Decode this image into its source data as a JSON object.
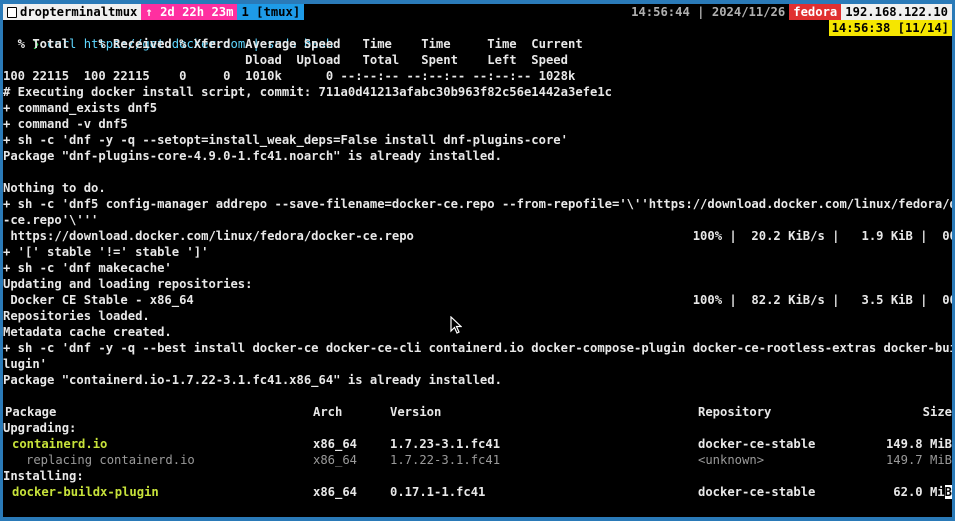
{
  "status_bar": {
    "session_name": "dropterminaltmux",
    "uptime": "↑ 2d 22h 23m",
    "window": "1 [tmux]",
    "time": "14:56:44",
    "separator": "|",
    "date": "2024/11/26",
    "hostname": "fedora",
    "ip": "192.168.122.10"
  },
  "mode_badge": "14:56:38 [11/14]",
  "prompt": {
    "glyph": "❯",
    "command": "curl https://get.docker.com | sudo bash"
  },
  "lines": [
    "  % Total    % Received % Xferd  Average Speed   Time    Time     Time  Current",
    "                                 Dload  Upload   Total   Spent    Left  Speed",
    "100 22115  100 22115    0     0  1010k      0 --:--:-- --:--:-- --:--:-- 1028k",
    "# Executing docker install script, commit: 711a0d41213afabc30b963f82c56e1442a3efe1c",
    "+ command_exists dnf5",
    "+ command -v dnf5",
    "+ sh -c 'dnf -y -q --setopt=install_weak_deps=False install dnf-plugins-core'",
    "Package \"dnf-plugins-core-4.9.0-1.fc41.noarch\" is already installed.",
    "",
    "Nothing to do.",
    "+ sh -c 'dnf5 config-manager addrepo --save-filename=docker-ce.repo --from-repofile='\\''https://download.docker.com/linux/fedora/docker",
    "-ce.repo'\\'''",
    " https://download.docker.com/linux/fedora/docker-ce.repo                                      100% |  20.2 KiB/s |   1.9 KiB |  00m00s",
    "+ '[' stable '!=' stable ']'",
    "+ sh -c 'dnf makecache'",
    "Updating and loading repositories:",
    " Docker CE Stable - x86_64                                                                    100% |  82.2 KiB/s |   3.5 KiB |  00m00s",
    "Repositories loaded.",
    "Metadata cache created.",
    "+ sh -c 'dnf -y -q --best install docker-ce docker-ce-cli containerd.io docker-compose-plugin docker-ce-rootless-extras docker-buildx-p",
    "lugin'",
    "Package \"containerd.io-1.7.22-3.1.fc41.x86_64\" is already installed.",
    ""
  ],
  "table": {
    "headers": {
      "package": "Package",
      "arch": "Arch",
      "version": "Version",
      "repository": "Repository",
      "size": "Size"
    },
    "upgrading_label": "Upgrading:",
    "installing_label": "Installing:",
    "rows": [
      {
        "package": "containerd.io",
        "arch": "x86_64",
        "version": "1.7.23-3.1.fc41",
        "repository": "docker-ce-stable",
        "size": "149.8 MiB"
      },
      {
        "package": "replacing containerd.io",
        "arch": "x86_64",
        "version": "1.7.22-3.1.fc41",
        "repository": "<unknown>",
        "size": "149.7 MiB"
      },
      {
        "package": "docker-buildx-plugin",
        "arch": "x86_64",
        "version": "0.17.1-1.fc41",
        "repository": "docker-ce-stable",
        "size": "62.0 Mi"
      }
    ],
    "cursor_char": "B"
  }
}
